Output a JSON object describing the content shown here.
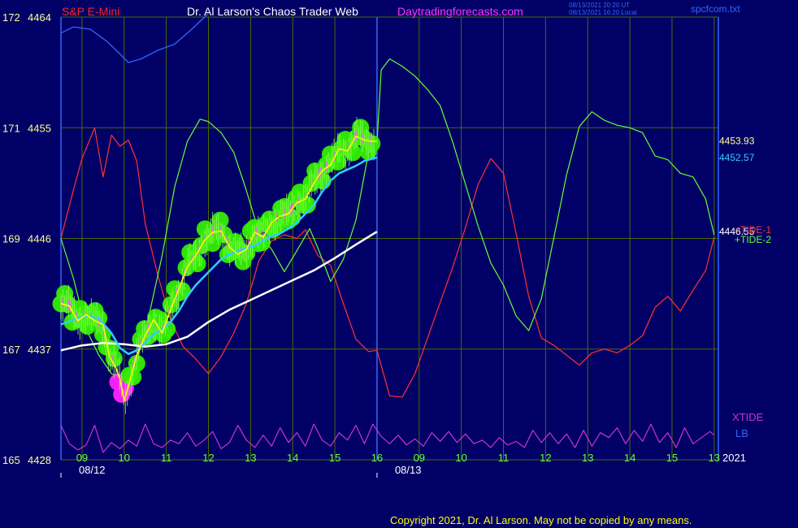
{
  "chart_data": {
    "type": "line",
    "instrument": "S&P E-Mini",
    "site_title": "Dr. Al Larson's Chaos Trader Web",
    "site_url": "Daytradingforecasts.com",
    "timestamps": [
      "08/13/2021 20:20 UT",
      "08/13/2021 16:20 Local"
    ],
    "source_file": "spcfcom.txt",
    "copyright": "Copyright 2021, Dr. Al Larson. May not be copied by any means.",
    "year": "2021",
    "y_axis": {
      "range": [
        4428,
        4464
      ],
      "ticks": [
        {
          "left": "172",
          "price": "4464",
          "value": 4464
        },
        {
          "left": "171",
          "price": "4455",
          "value": 4455
        },
        {
          "left": "169",
          "price": "4446",
          "value": 4446
        },
        {
          "left": "167",
          "price": "4437",
          "value": 4437
        },
        {
          "left": "165",
          "price": "4428",
          "value": 4428
        }
      ]
    },
    "x_axis": {
      "range": [
        8.5,
        24.1
      ],
      "hour_labels": [
        {
          "text": "09",
          "x": 9
        },
        {
          "text": "10",
          "x": 10
        },
        {
          "text": "11",
          "x": 11
        },
        {
          "text": "12",
          "x": 12
        },
        {
          "text": "13",
          "x": 13
        },
        {
          "text": "14",
          "x": 14
        },
        {
          "text": "15",
          "x": 15
        },
        {
          "text": "16",
          "x": 16
        },
        {
          "text": "09",
          "x": 17
        },
        {
          "text": "10",
          "x": 18
        },
        {
          "text": "11",
          "x": 19
        },
        {
          "text": "12",
          "x": 20
        },
        {
          "text": "13",
          "x": 21
        },
        {
          "text": "14",
          "x": 22
        },
        {
          "text": "15",
          "x": 23
        },
        {
          "text": "13",
          "x": 24
        }
      ],
      "date_labels": [
        {
          "text": "08/12",
          "x": 8.5
        },
        {
          "text": "08/13",
          "x": 16
        }
      ],
      "session_divider_x": 16
    },
    "right_labels": [
      {
        "text": "4453.93",
        "value": 4453.93,
        "color": "#ffff99"
      },
      {
        "text": "4452.57",
        "value": 4452.57,
        "color": "#33ccff"
      },
      {
        "text": "4446.55",
        "value": 4446.55,
        "color": "#ffffff"
      }
    ],
    "legend": [
      {
        "text": "+TIDE-1",
        "color": "#ff3333"
      },
      {
        "text": "+TIDE-2",
        "color": "#66ff33"
      },
      {
        "text": "XTIDE",
        "color": "#cc33cc"
      },
      {
        "text": "LB",
        "color": "#3366ff"
      }
    ],
    "colors": {
      "background": "#000066",
      "grid": "#4a6b00",
      "axis": "#3366ff",
      "price_close": "#ffff00",
      "price_ma": "#33ccff",
      "long_ma": "#ffffff",
      "bar_ticks": "#66dd22",
      "bubble_green": "#33ee00",
      "bubble_magenta": "#ff22ff",
      "tide1": "#ff3333",
      "tide2": "#66ff33",
      "xtide": "#cc33cc",
      "lb": "#3366ff",
      "title_left": "#ff2222",
      "title_mid": "#ffffff",
      "title_url": "#ff33ff",
      "tick_text": "#ffff99"
    },
    "series": [
      {
        "name": "close",
        "color": "#ffff00",
        "x": [
          8.5,
          8.7,
          8.9,
          9.1,
          9.3,
          9.5,
          9.65,
          9.8,
          9.9,
          10.0,
          10.1,
          10.3,
          10.5,
          10.7,
          10.9,
          11.1,
          11.3,
          11.5,
          11.7,
          11.9,
          12.1,
          12.3,
          12.5,
          12.7,
          12.9,
          13.1,
          13.3,
          13.5,
          13.7,
          13.9,
          14.1,
          14.3,
          14.5,
          14.7,
          14.9,
          15.1,
          15.3,
          15.5,
          15.7,
          15.85,
          16.0
        ],
        "y": [
          4440.7,
          4440.5,
          4439.3,
          4439.8,
          4439.3,
          4439.0,
          4436.4,
          4435.5,
          4434.6,
          4432.8,
          4434.0,
          4436.5,
          4438.1,
          4439.4,
          4438.3,
          4440.2,
          4441.9,
          4443.7,
          4444.6,
          4445.8,
          4446.5,
          4446.6,
          4445.3,
          4444.7,
          4445.1,
          4446.5,
          4446.1,
          4447.3,
          4447.8,
          4448.0,
          4448.9,
          4449.2,
          4450.5,
          4451.5,
          4452.0,
          4453.3,
          4453.1,
          4454.3,
          4454.0,
          4453.9,
          4453.9
        ]
      },
      {
        "name": "moving-average",
        "color": "#33ccff",
        "x": [
          8.5,
          8.8,
          9.1,
          9.4,
          9.7,
          9.9,
          10.1,
          10.3,
          10.5,
          10.7,
          10.9,
          11.1,
          11.3,
          11.5,
          11.7,
          11.9,
          12.1,
          12.3,
          12.5,
          12.7,
          12.9,
          13.1,
          13.3,
          13.5,
          13.7,
          13.9,
          14.1,
          14.3,
          14.5,
          14.7,
          14.9,
          15.1,
          15.3,
          15.5,
          15.7,
          16.0
        ],
        "y": [
          4439.0,
          4439.4,
          4439.7,
          4439.5,
          4438.3,
          4437.1,
          4436.6,
          4436.9,
          4437.5,
          4438.2,
          4438.6,
          4439.2,
          4440.1,
          4441.3,
          4442.2,
          4442.9,
          4443.6,
          4444.3,
          4444.7,
          4445.0,
          4445.2,
          4445.4,
          4445.8,
          4446.2,
          4446.4,
          4446.8,
          4447.3,
          4448.0,
          4448.7,
          4449.8,
          4450.7,
          4451.3,
          4451.6,
          4451.9,
          4452.3,
          4452.57
        ]
      },
      {
        "name": "long-average",
        "color": "#ffffff",
        "x": [
          8.5,
          9.0,
          9.5,
          10.0,
          10.5,
          11.0,
          11.5,
          12.0,
          12.5,
          13.0,
          13.5,
          14.0,
          14.5,
          15.0,
          15.5,
          16.0
        ],
        "y": [
          4436.9,
          4437.3,
          4437.5,
          4437.4,
          4437.2,
          4437.4,
          4438.0,
          4439.2,
          4440.2,
          4441.0,
          4441.8,
          4442.6,
          4443.4,
          4444.4,
          4445.5,
          4446.55
        ]
      },
      {
        "name": "+TIDE-1",
        "color": "#ff3333",
        "x": [
          8.5,
          8.8,
          9.0,
          9.3,
          9.5,
          9.7,
          9.9,
          10.1,
          10.3,
          10.5,
          10.8,
          11.1,
          11.4,
          11.7,
          12.0,
          12.3,
          12.6,
          12.9,
          13.2,
          13.5,
          13.8,
          14.1,
          14.3,
          14.6,
          14.9,
          15.2,
          15.5,
          15.8,
          16.0,
          16.3,
          16.6,
          16.9,
          17.2,
          17.5,
          17.8,
          18.1,
          18.4,
          18.7,
          19.0,
          19.3,
          19.6,
          19.9,
          20.2,
          20.5,
          20.8,
          21.1,
          21.4,
          21.7,
          22.0,
          22.3,
          22.6,
          22.9,
          23.2,
          23.5,
          23.8,
          24.0
        ],
        "y": [
          4446.0,
          4450.0,
          4452.5,
          4455.0,
          4451.0,
          4454.4,
          4453.5,
          4454.0,
          4452.3,
          4447.2,
          4443.0,
          4439.4,
          4437.2,
          4436.2,
          4435.0,
          4436.4,
          4438.3,
          4440.7,
          4444.2,
          4445.8,
          4446.3,
          4446.0,
          4446.7,
          4444.6,
          4443.8,
          4440.7,
          4437.8,
          4436.8,
          4436.9,
          4433.2,
          4433.1,
          4435.0,
          4437.9,
          4440.8,
          4443.7,
          4446.9,
          4450.4,
          4452.5,
          4451.3,
          4446.4,
          4441.3,
          4437.9,
          4437.3,
          4436.5,
          4435.7,
          4436.7,
          4437.0,
          4436.7,
          4437.3,
          4438.1,
          4440.4,
          4441.3,
          4440.1,
          4441.8,
          4443.4,
          4446.1
        ]
      },
      {
        "name": "+TIDE-2",
        "color": "#66ff33",
        "x": [
          8.5,
          8.8,
          9.1,
          9.4,
          9.7,
          10.0,
          10.3,
          10.6,
          10.9,
          11.2,
          11.5,
          11.8,
          12.0,
          12.3,
          12.6,
          12.9,
          13.2,
          13.5,
          13.8,
          14.1,
          14.4,
          14.6,
          14.9,
          15.2,
          15.5,
          15.8,
          16.0,
          16.1,
          16.3,
          16.6,
          16.9,
          17.2,
          17.5,
          17.8,
          18.1,
          18.4,
          18.7,
          19.0,
          19.3,
          19.6,
          19.9,
          20.2,
          20.5,
          20.8,
          21.1,
          21.4,
          21.7,
          22.0,
          22.3,
          22.6,
          22.9,
          23.2,
          23.5,
          23.8,
          24.0
        ],
        "y": [
          4446.0,
          4442.7,
          4438.6,
          4436.5,
          4435.0,
          4434.6,
          4436.0,
          4439.9,
          4444.6,
          4450.2,
          4453.9,
          4455.7,
          4455.5,
          4454.6,
          4453.0,
          4449.9,
          4446.5,
          4445.1,
          4443.3,
          4445.0,
          4446.8,
          4445.2,
          4442.5,
          4444.3,
          4447.5,
          4453.0,
          4453.8,
          4459.7,
          4460.6,
          4460.0,
          4459.2,
          4458.1,
          4456.8,
          4453.8,
          4450.4,
          4447.0,
          4444.0,
          4442.2,
          4439.7,
          4438.5,
          4441.1,
          4446.1,
          4451.2,
          4455.1,
          4456.3,
          4455.6,
          4455.2,
          4455.0,
          4454.6,
          4452.7,
          4452.4,
          4451.3,
          4451.0,
          4449.2,
          4446.3
        ]
      },
      {
        "name": "XTIDE",
        "color": "#cc33cc",
        "x": [
          8.5,
          8.7,
          8.9,
          9.1,
          9.3,
          9.5,
          9.7,
          9.9,
          10.1,
          10.3,
          10.5,
          10.7,
          10.9,
          11.1,
          11.3,
          11.5,
          11.7,
          11.9,
          12.1,
          12.3,
          12.5,
          12.7,
          12.9,
          13.1,
          13.3,
          13.5,
          13.7,
          13.9,
          14.1,
          14.3,
          14.5,
          14.7,
          14.9,
          15.1,
          15.3,
          15.5,
          15.7,
          15.9,
          16.1,
          16.3,
          16.5,
          16.7,
          16.9,
          17.1,
          17.3,
          17.5,
          17.7,
          17.9,
          18.1,
          18.3,
          18.5,
          18.7,
          18.9,
          19.1,
          19.3,
          19.5,
          19.7,
          19.9,
          20.1,
          20.3,
          20.5,
          20.7,
          20.9,
          21.1,
          21.3,
          21.5,
          21.7,
          21.9,
          22.1,
          22.3,
          22.5,
          22.7,
          22.9,
          23.1,
          23.3,
          23.5,
          23.7,
          23.9,
          24.0
        ],
        "y": [
          4430.8,
          4429.3,
          4428.8,
          4429.2,
          4430.8,
          4428.6,
          4429.4,
          4428.9,
          4429.6,
          4429.1,
          4430.9,
          4429.3,
          4429.0,
          4429.6,
          4429.3,
          4430.2,
          4429.1,
          4429.6,
          4430.3,
          4428.9,
          4429.4,
          4430.8,
          4429.6,
          4429.0,
          4430.0,
          4429.1,
          4430.6,
          4429.4,
          4430.2,
          4429.1,
          4430.9,
          4429.6,
          4429.1,
          4430.2,
          4429.6,
          4430.8,
          4429.3,
          4430.9,
          4429.9,
          4429.3,
          4430.0,
          4429.2,
          4429.7,
          4429.1,
          4430.2,
          4429.5,
          4430.3,
          4429.4,
          4430.1,
          4429.3,
          4429.6,
          4429.0,
          4429.8,
          4429.2,
          4429.5,
          4429.0,
          4430.4,
          4429.4,
          4430.2,
          4429.3,
          4430.1,
          4429.0,
          4430.4,
          4429.1,
          4430.2,
          4429.8,
          4430.6,
          4429.3,
          4430.4,
          4429.5,
          4430.9,
          4429.4,
          4430.2,
          4429.0,
          4430.6,
          4429.3,
          4429.8,
          4430.3,
          4430.0
        ]
      },
      {
        "name": "LB",
        "color": "#3366ff",
        "x": [
          8.5,
          8.8,
          9.2,
          9.6,
          9.9,
          10.1,
          10.4,
          10.8,
          11.2,
          11.6,
          12.0
        ],
        "y": [
          4462.7,
          4463.2,
          4463.0,
          4462.0,
          4461.0,
          4460.3,
          4460.6,
          4461.3,
          4461.8,
          4463.0,
          4464.3
        ]
      }
    ]
  }
}
